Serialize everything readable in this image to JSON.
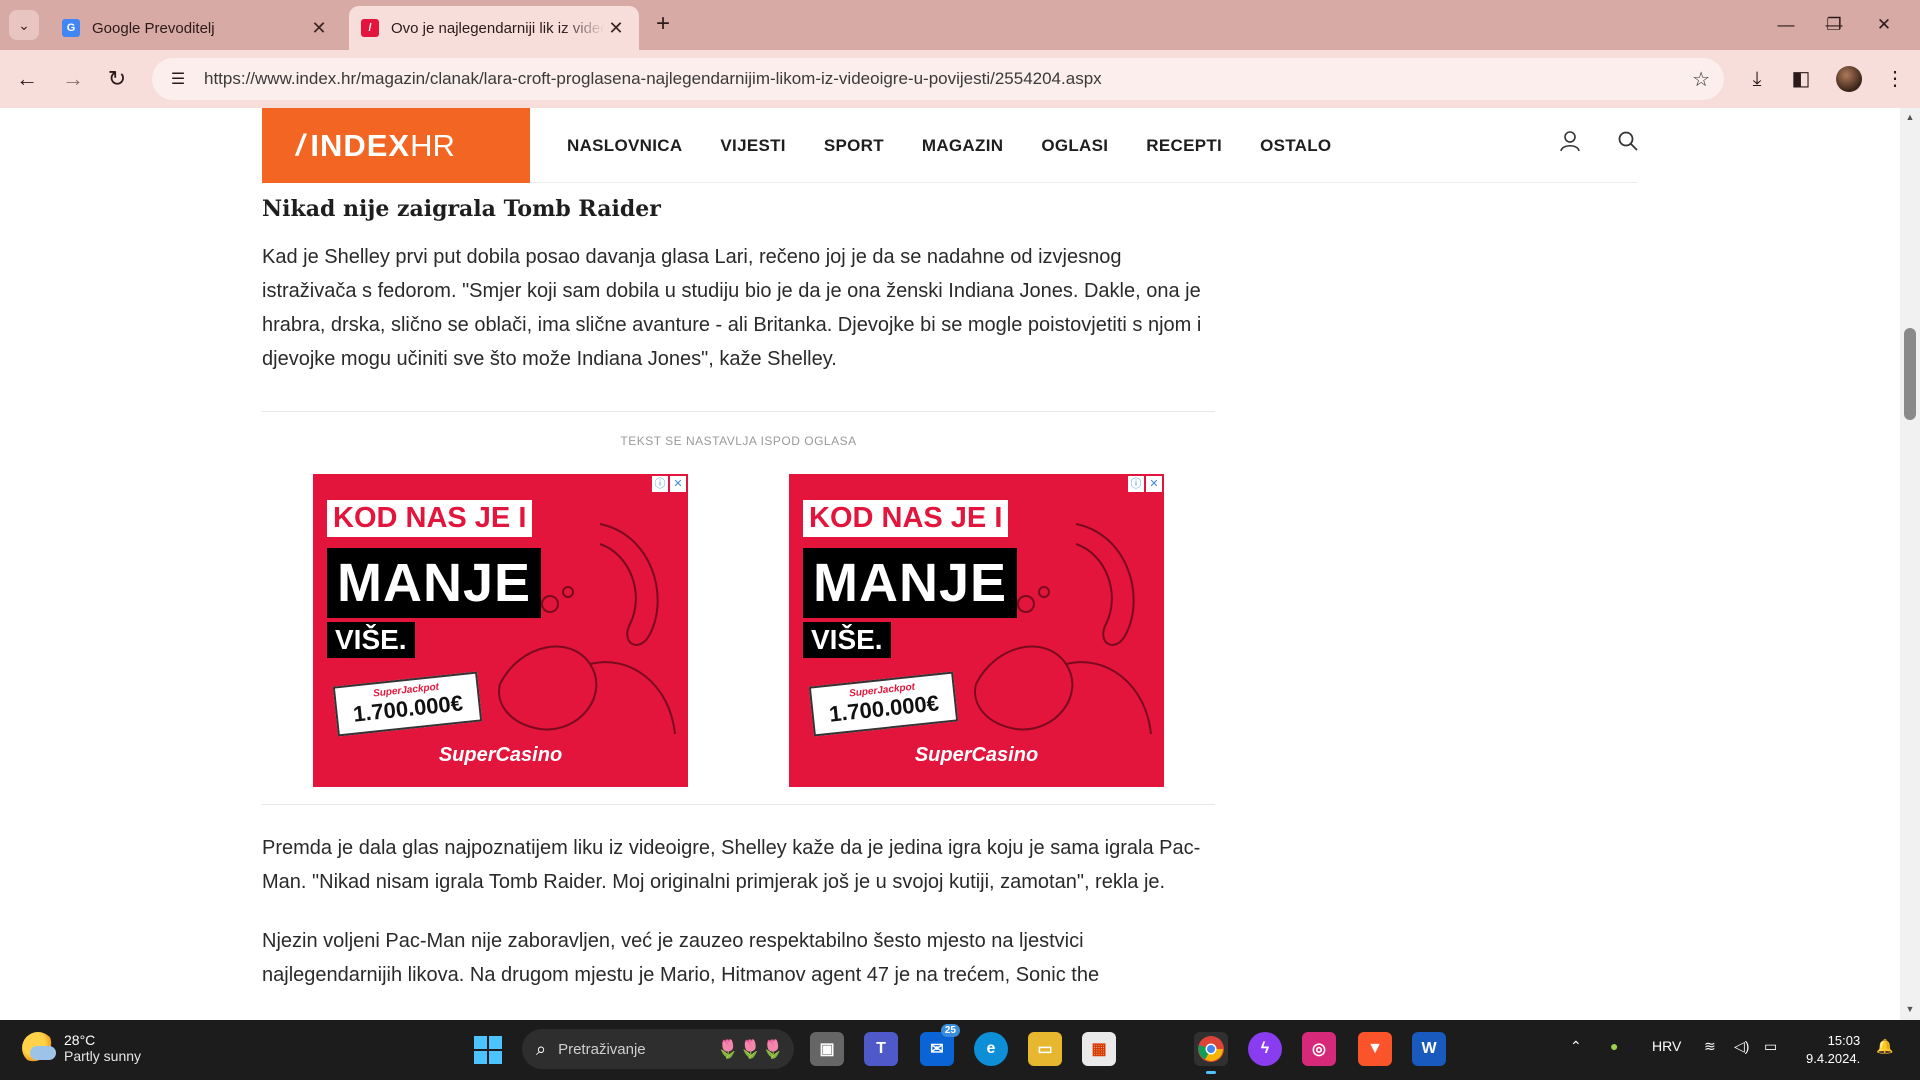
{
  "browser": {
    "tabs": [
      {
        "title": "Google Prevoditelj",
        "favicon": "google-translate-icon",
        "active": false
      },
      {
        "title": "Ovo je najlegendarniji lik iz videoigre",
        "favicon": "index-hr-icon",
        "active": true
      }
    ],
    "url": "https://www.index.hr/magazin/clanak/lara-croft-proglasena-najlegendarnijim-likom-iz-videoigre-u-povijesti/2554204.aspx"
  },
  "site": {
    "logo_index": "INDEX",
    "logo_hr": "HR",
    "nav": [
      "NASLOVNICA",
      "VIJESTI",
      "SPORT",
      "MAGAZIN",
      "OGLASI",
      "RECEPTI",
      "OSTALO"
    ]
  },
  "article": {
    "heading": "Nikad nije zaigrala Tomb Raider",
    "para1": "Kad je Shelley prvi put dobila posao davanja glasa Lari, rečeno joj je da se nadahne od izvjesnog istraživača s fedorom. \"Smjer koji sam dobila u studiju bio je da je ona ženski Indiana Jones. Dakle, ona je hrabra, drska, slično se oblači, ima slične avanture - ali Britanka. Djevojke bi se mogle poistovjetiti s njom i djevojke mogu učiniti sve što može Indiana Jones\", kaže Shelley.",
    "ad_notice": "TEKST SE NASTAVLJA ISPOD OGLASA",
    "para2": "Premda je dala glas najpoznatijem liku iz videoigre, Shelley kaže da je jedina igra koju je sama igrala Pac-Man. \"Nikad nisam igrala Tomb Raider. Moj originalni primjerak još je u svojoj kutiji, zamotan\", rekla je.",
    "para3": "Njezin voljeni Pac-Man nije zaboravljen, već je zauzeo respektabilno šesto mjesto na ljestvici najlegendarnijih likova. Na drugom mjestu je Mario, Hitmanov agent 47 je na trećem, Sonic the"
  },
  "ad": {
    "line1": "KOD NAS JE I",
    "line2": "MANJE",
    "line3": "VIŠE.",
    "jackpot_label": "SuperJackpot",
    "jackpot_amount": "1.700.000€",
    "brand": "SuperCasino"
  },
  "taskbar": {
    "weather_temp": "28°C",
    "weather_cond": "Partly sunny",
    "search_placeholder": "Pretraživanje",
    "mail_badge": "25",
    "language": "HRV",
    "time": "15:03",
    "date": "9.4.2024."
  }
}
